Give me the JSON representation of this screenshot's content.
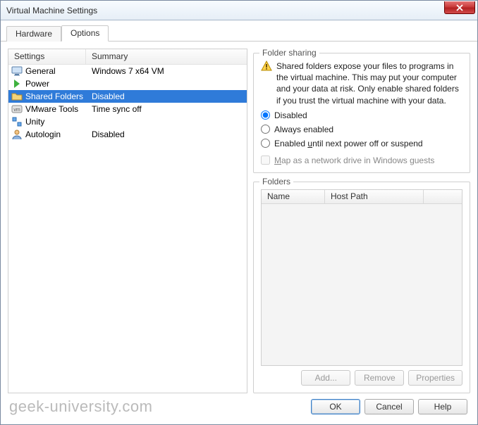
{
  "window": {
    "title": "Virtual Machine Settings"
  },
  "tabs": {
    "hardware": "Hardware",
    "options": "Options"
  },
  "left": {
    "headers": {
      "settings": "Settings",
      "summary": "Summary"
    },
    "rows": [
      {
        "icon": "monitor-icon",
        "name": "General",
        "summary": "Windows 7 x64 VM"
      },
      {
        "icon": "power-icon",
        "name": "Power",
        "summary": ""
      },
      {
        "icon": "folder-icon",
        "name": "Shared Folders",
        "summary": "Disabled",
        "selected": true
      },
      {
        "icon": "vm-icon",
        "name": "VMware Tools",
        "summary": "Time sync off"
      },
      {
        "icon": "unity-icon",
        "name": "Unity",
        "summary": ""
      },
      {
        "icon": "user-icon",
        "name": "Autologin",
        "summary": "Disabled"
      }
    ]
  },
  "sharing": {
    "legend": "Folder sharing",
    "warning": "Shared folders expose your files to programs in the virtual machine. This may put your computer and your data at risk. Only enable shared folders if you trust the virtual machine with your data.",
    "radios": {
      "disabled": "Disabled",
      "always": "Always enabled",
      "until": "Enabled until next power off or suspend"
    },
    "selected": "disabled",
    "map_checkbox": "Map as a network drive in Windows guests",
    "map_checked": false,
    "map_enabled": false
  },
  "folders": {
    "legend": "Folders",
    "headers": {
      "name": "Name",
      "host": "Host Path"
    },
    "rows": [],
    "buttons": {
      "add": "Add...",
      "remove": "Remove",
      "properties": "Properties"
    }
  },
  "footer": {
    "ok": "OK",
    "cancel": "Cancel",
    "help": "Help"
  },
  "watermark": "geek-university.com"
}
